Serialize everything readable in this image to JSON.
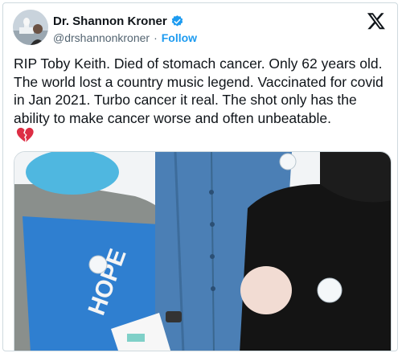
{
  "author": {
    "name": "Dr. Shannon Kroner",
    "handle": "@drshannonkroner",
    "separator": "·",
    "follow_label": "Follow",
    "verified": true
  },
  "icons": {
    "avatar": "profile-photo-capitol",
    "verified": "verified-badge-icon",
    "platform": "x-logo-icon",
    "emoji": "broken-heart-emoji"
  },
  "tweet": {
    "text": "RIP Toby Keith. Died of stomach cancer. Only 62 years old. The world lost a country music legend. Vaccinated for covid in Jan 2021. Turbo cancer it real. The shot only has the ability to make cancer worse and often unbeatable."
  },
  "media": {
    "shirt_text": "HOPE",
    "description_colors": {
      "blue_shirt": "#2f7fd0",
      "denim": "#4b7fb5",
      "black_top": "#141414",
      "cardigan": "#8a8f8c",
      "mask": "#4fb7e0"
    }
  },
  "colors": {
    "accent": "#1d9bf0",
    "text": "#0f1419",
    "secondary_text": "#536471"
  }
}
